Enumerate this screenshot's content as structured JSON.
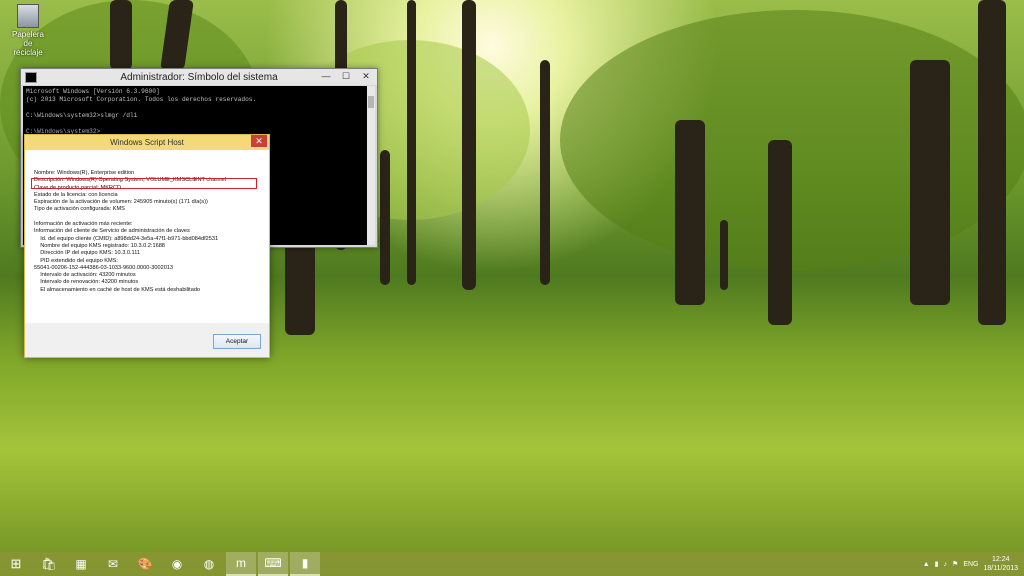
{
  "desktop": {
    "icon_label": "Papelera de reciclaje"
  },
  "cmd": {
    "title": "Administrador: Símbolo del sistema",
    "lines": [
      "Microsoft Windows [Versión 6.3.9600]",
      "(c) 2013 Microsoft Corporation. Todos los derechos reservados.",
      "",
      "C:\\Windows\\system32>slmgr /dli",
      "",
      "C:\\Windows\\system32>"
    ]
  },
  "wsh": {
    "title": "Windows Script Host",
    "lines": [
      "Nombre: Windows(R), Enterprise edition",
      "Descripción: Windows(R) Operating System, VOLUME_KMSCLIENT channel",
      "Clave de producto parcial: MKRCD",
      "Estado de la licencia: con licencia",
      "Expiración de la activación de volumen: 245905 minuto(s) (171 día(s))",
      "Tipo de activación configurada: KMS",
      "",
      "Información de activación más reciente:",
      "Información del cliente de Servicio de administración de claves",
      "    Id. del equipo cliente (CMID): a898dd24-3e5a-47f1-b971-bbd084df2531",
      "    Nombre del equipo KMS registrado: 10.3.0.2:1688",
      "    Dirección IP del equipo KMS: 10.3.0.111",
      "    PID extendido del equipo KMS:",
      "55041-00206-152-444386-03-1033-9600.0000-3002013",
      "    Intervalo de activación: 43200 minutos",
      "    Intervalo de renovación: 43200 minutos",
      "    El almacenamiento en caché de host de KMS está deshabilitado"
    ],
    "accept_label": "Aceptar"
  },
  "taskbar": {
    "items": [
      {
        "name": "store",
        "glyph": "🛍"
      },
      {
        "name": "file-explorer",
        "glyph": "▦"
      },
      {
        "name": "outlook",
        "glyph": "✉"
      },
      {
        "name": "paint",
        "glyph": "🎨"
      },
      {
        "name": "chrome",
        "glyph": "◉"
      },
      {
        "name": "firefox",
        "glyph": "◍"
      },
      {
        "name": "maxthon",
        "glyph": "m"
      },
      {
        "name": "cmd",
        "glyph": "⌨"
      },
      {
        "name": "app",
        "glyph": "▮"
      }
    ],
    "lang": "ENG",
    "time": "12:24",
    "date": "18/11/2013"
  }
}
